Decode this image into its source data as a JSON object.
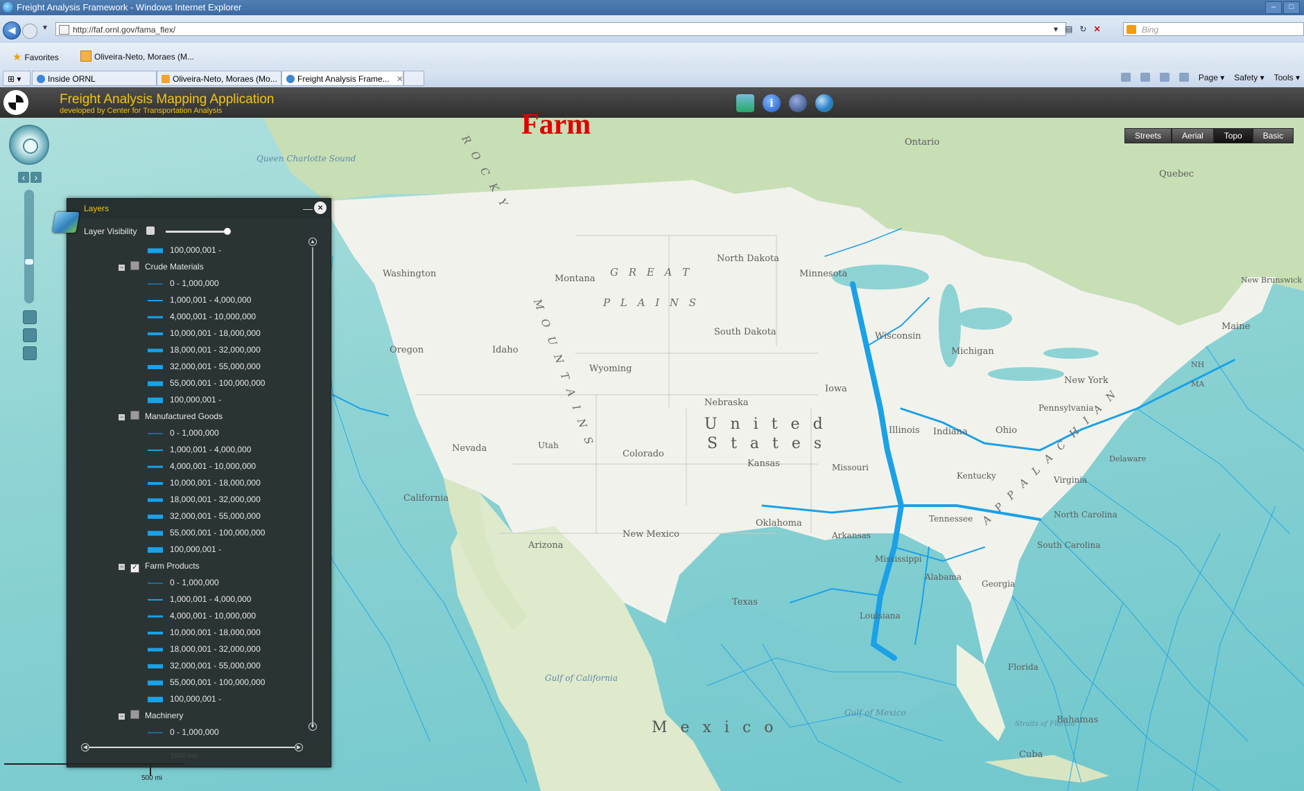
{
  "browser": {
    "title": "Freight Analysis Framework - Windows Internet Explorer",
    "url": "http://faf.ornl.gov/fama_flex/",
    "search_placeholder": "Bing",
    "favorites_label": "Favorites",
    "favorites_feed": "Oliveira-Neto, Moraes (M...",
    "tabs": [
      {
        "label": "Inside ORNL"
      },
      {
        "label": "Oliveira-Neto, Moraes (Mo..."
      },
      {
        "label": "Freight Analysis Frame..."
      }
    ],
    "commands": {
      "page": "Page ▾",
      "safety": "Safety ▾",
      "tools": "Tools ▾"
    }
  },
  "app": {
    "title": "Freight Analysis Mapping Application",
    "subtitle": "developed by Center for Transportation Analysis",
    "info_icon_glyph": "i"
  },
  "overlay_title": "Farm",
  "basemaps": [
    "Streets",
    "Aerial",
    "Topo",
    "Basic"
  ],
  "layers_panel": {
    "title": "Layers",
    "visibility_label": "Layer Visibility",
    "minimize_glyph": "—",
    "close_glyph": "×",
    "items": [
      {
        "type": "legend",
        "label": "100,000,001 -",
        "w": 7
      },
      {
        "type": "group",
        "label": "Crude Materials",
        "checked": false
      },
      {
        "type": "legend",
        "label": "0 - 1,000,000",
        "w": 1
      },
      {
        "type": "legend",
        "label": "1,000,001 - 4,000,000",
        "w": 2
      },
      {
        "type": "legend",
        "label": "4,000,001 - 10,000,000",
        "w": 3
      },
      {
        "type": "legend",
        "label": "10,000,001 - 18,000,000",
        "w": 4
      },
      {
        "type": "legend",
        "label": "18,000,001 - 32,000,000",
        "w": 5
      },
      {
        "type": "legend",
        "label": "32,000,001 - 55,000,000",
        "w": 6
      },
      {
        "type": "legend",
        "label": "55,000,001 - 100,000,000",
        "w": 7
      },
      {
        "type": "legend",
        "label": "100,000,001 -",
        "w": 8
      },
      {
        "type": "group",
        "label": "Manufactured Goods",
        "checked": false
      },
      {
        "type": "legend",
        "label": "0 - 1,000,000",
        "w": 1
      },
      {
        "type": "legend",
        "label": "1,000,001 - 4,000,000",
        "w": 2
      },
      {
        "type": "legend",
        "label": "4,000,001 - 10,000,000",
        "w": 3
      },
      {
        "type": "legend",
        "label": "10,000,001 - 18,000,000",
        "w": 4
      },
      {
        "type": "legend",
        "label": "18,000,001 - 32,000,000",
        "w": 5
      },
      {
        "type": "legend",
        "label": "32,000,001 - 55,000,000",
        "w": 6
      },
      {
        "type": "legend",
        "label": "55,000,001 - 100,000,000",
        "w": 7
      },
      {
        "type": "legend",
        "label": "100,000,001 -",
        "w": 8
      },
      {
        "type": "group",
        "label": "Farm Products",
        "checked": true
      },
      {
        "type": "legend",
        "label": "0 - 1,000,000",
        "w": 1
      },
      {
        "type": "legend",
        "label": "1,000,001 - 4,000,000",
        "w": 2
      },
      {
        "type": "legend",
        "label": "4,000,001 - 10,000,000",
        "w": 3
      },
      {
        "type": "legend",
        "label": "10,000,001 - 18,000,000",
        "w": 4
      },
      {
        "type": "legend",
        "label": "18,000,001 - 32,000,000",
        "w": 5
      },
      {
        "type": "legend",
        "label": "32,000,001 - 55,000,000",
        "w": 6
      },
      {
        "type": "legend",
        "label": "55,000,001 - 100,000,000",
        "w": 7
      },
      {
        "type": "legend",
        "label": "100,000,001 -",
        "w": 8
      },
      {
        "type": "group",
        "label": "Machinery",
        "checked": false
      },
      {
        "type": "legend",
        "label": "0 - 1,000,000",
        "w": 1
      }
    ]
  },
  "scale": {
    "km": "1000 km",
    "mi": "500 mi"
  },
  "map_labels": {
    "ontario": "Ontario",
    "quebec": "Quebec",
    "new_brunswick": "New Brunswick",
    "washington": "Washington",
    "montana": "Montana",
    "north_dakota": "North Dakota",
    "minnesota": "Minnesota",
    "great": "G R E A T",
    "plains": "P L A I N S",
    "oregon": "Oregon",
    "idaho": "Idaho",
    "south_dakota": "South Dakota",
    "wisconsin": "Wisconsin",
    "michigan": "Michigan",
    "maine": "Maine",
    "wyoming": "Wyoming",
    "iowa": "Iowa",
    "new_york": "New York",
    "nebraska": "Nebraska",
    "pennsylvania": "Pennsylvania",
    "nevada": "Nevada",
    "utah": "Utah",
    "colorado": "Colorado",
    "united": "U n i t e d",
    "states": "S t a t e s",
    "illinois": "Illinois",
    "indiana": "Indiana",
    "ohio": "Ohio",
    "kansas": "Kansas",
    "missouri": "Missouri",
    "kentucky": "Kentucky",
    "virginia": "Virginia",
    "california": "California",
    "delaware": "Delaware",
    "tennessee": "Tennessee",
    "north_carolina": "North Carolina",
    "oklahoma": "Oklahoma",
    "arkansas": "Arkansas",
    "new_mexico": "New Mexico",
    "arizona": "Arizona",
    "south_carolina": "South Carolina",
    "mississippi": "Mississippi",
    "alabama": "Alabama",
    "georgia": "Georgia",
    "texas": "Texas",
    "louisiana": "Louisiana",
    "florida": "Florida",
    "mexico": "M e x i c o",
    "bahamas": "Bahamas",
    "cuba": "Cuba",
    "gulf_california": "Gulf of California",
    "gulf_mexico": "Gulf of Mexico",
    "queen_charlotte": "Queen Charlotte Sound",
    "straits_florida": "Straits of Florida",
    "rocky": "R O C K Y",
    "mountains": "M O U N T A I N S",
    "appalachian": "A P P A L A C H I A N",
    "nh": "NH",
    "ma": "MA"
  },
  "colors": {
    "flow": "#1aa1e6",
    "header_gold": "#f3c512",
    "overlay_red": "#e00000"
  }
}
